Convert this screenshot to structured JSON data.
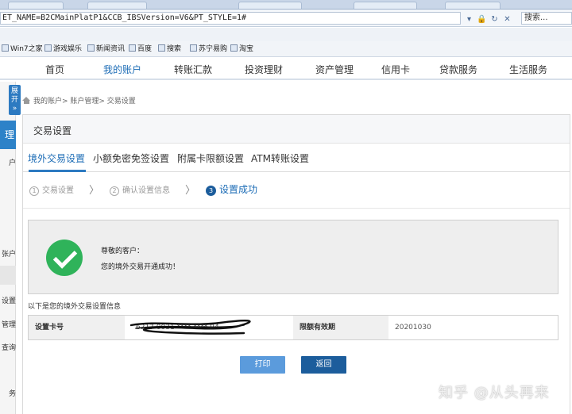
{
  "browser": {
    "url": "ET_NAME=B2CMainPlatP1&CCB_IBSVersion=V6&PT_STYLE=1#",
    "search_label": "搜索...",
    "favorites": [
      "Win7之家",
      "游戏娱乐",
      "新闻资讯",
      "百度",
      "搜索",
      "苏宁易购",
      "淘宝"
    ]
  },
  "nav": {
    "items": [
      "首页",
      "我的账户",
      "转账汇款",
      "投资理财",
      "资产管理",
      "信用卡",
      "贷款服务",
      "生活服务"
    ],
    "active_index": 1
  },
  "sidebar": {
    "expand_label": "展开",
    "expand_arrow": "»",
    "active_label": "理",
    "items": [
      "户",
      "张户",
      "设置",
      "管理",
      "查询",
      "务"
    ]
  },
  "breadcrumb": {
    "text": "我的账户> 账户管理> 交易设置"
  },
  "panel": {
    "title": "交易设置",
    "tabs": [
      "境外交易设置",
      "小额免密免签设置",
      "附属卡限额设置",
      "ATM转账设置"
    ],
    "active_tab": 0
  },
  "steps": [
    {
      "num": "1",
      "label": "交易设置"
    },
    {
      "num": "2",
      "label": "确认设置信息"
    },
    {
      "num": "3",
      "label": "设置成功"
    }
  ],
  "step_separator": "〉",
  "message": {
    "greeting": "尊敬的客户：",
    "body": "您的境外交易开通成功！"
  },
  "info": {
    "caption": "以下是您的境外交易设置信息",
    "card_label": "设置卡号",
    "card_value": "6217 0031 **** **** 94",
    "expiry_label": "限额有效期",
    "expiry_value": "20201030"
  },
  "buttons": {
    "print": "打印",
    "back": "返回"
  },
  "watermark": "知乎 @从头再来",
  "colors": {
    "accent": "#1c6cb6",
    "success": "#2fb35a",
    "button_primary": "#1c5d9c",
    "button_secondary": "#5b9bdc"
  }
}
